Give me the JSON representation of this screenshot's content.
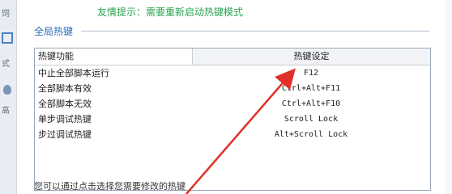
{
  "hint_text": "友情提示：需要重新启动热键模式",
  "section_title": "全局热键",
  "table": {
    "col_function": "热键功能",
    "col_setting": "热键设定",
    "rows": [
      {
        "function": "中止全部脚本运行",
        "hotkey": "F12"
      },
      {
        "function": "全部脚本有效",
        "hotkey": "Ctrl+Alt+F11"
      },
      {
        "function": "全部脚本无效",
        "hotkey": "Ctrl+Alt+F10"
      },
      {
        "function": "单步调试热键",
        "hotkey": "Scroll Lock"
      },
      {
        "function": "步过调试热键",
        "hotkey": "Alt+Scroll Lock"
      }
    ]
  },
  "footer_text": "您可以通过点击选择您需要修改的热键",
  "left_strip": {
    "frag1": "饲",
    "frag2": "式",
    "frag3": "高"
  },
  "arrow_color": "#e0302a"
}
